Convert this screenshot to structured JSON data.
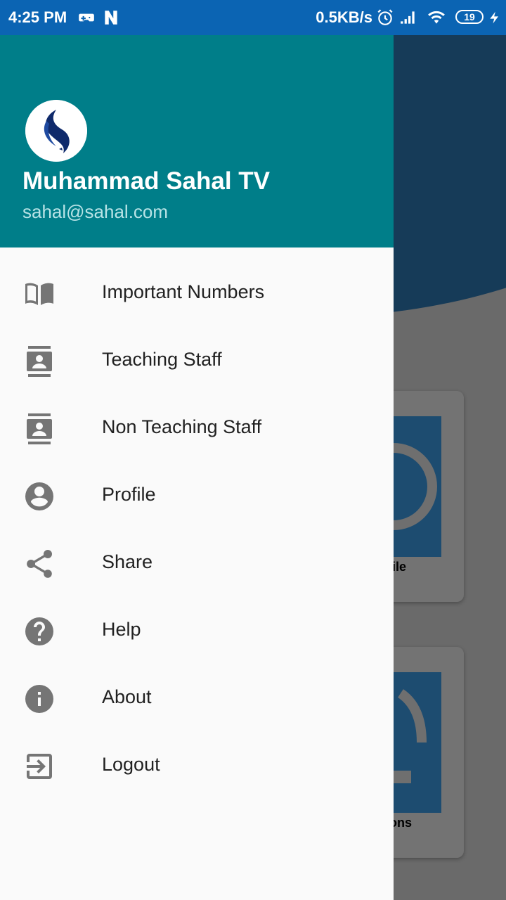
{
  "status_bar": {
    "time": "4:25 PM",
    "network_speed": "0.5KB/s",
    "battery": "19",
    "icons": [
      "game-icon",
      "n-icon",
      "alarm-icon",
      "signal-icon",
      "wifi-icon",
      "battery-icon",
      "charging-icon"
    ]
  },
  "drawer": {
    "header": {
      "name": "Muhammad Sahal TV",
      "email": "sahal@sahal.com",
      "header_color": "#007e89"
    },
    "items": [
      {
        "label": "Important Numbers",
        "icon": "book-icon"
      },
      {
        "label": "Teaching Staff",
        "icon": "contact-card-icon"
      },
      {
        "label": "Non Teaching Staff",
        "icon": "contact-card-icon"
      },
      {
        "label": "Profile",
        "icon": "account-circle-icon"
      },
      {
        "label": "Share",
        "icon": "share-icon"
      },
      {
        "label": "Help",
        "icon": "help-icon"
      },
      {
        "label": "About",
        "icon": "info-icon"
      },
      {
        "label": "Logout",
        "icon": "logout-icon"
      }
    ]
  },
  "background": {
    "card_labels": [
      "ile",
      "ons"
    ]
  }
}
